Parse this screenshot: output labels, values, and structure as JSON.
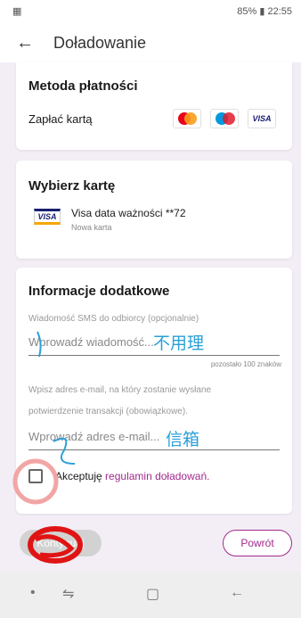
{
  "status_bar": {
    "left_icon": "image-icon",
    "right_text": "85% ▮ 22:55"
  },
  "app_bar": {
    "title": "Doładowanie",
    "back_icon": "←"
  },
  "payment": {
    "title": "Metoda płatności",
    "pay_label": "Zapłać kartą",
    "visa_text": "VISA"
  },
  "card_select": {
    "title": "Wybierz kartę",
    "card_name": "Visa data ważności **72",
    "card_sub": "Nowa karta",
    "visa_text": "VISA"
  },
  "additional": {
    "title": "Informacje dodatkowe",
    "sms_label": "Wiadomość SMS do odbiorcy (opcjonalnie)",
    "sms_placeholder": "Wprowadź wiadomość...",
    "sms_handwritten": "不用理",
    "counter": "pozostało 100 znaków",
    "email_label_line1": "Wpisz adres e-mail, na który zostanie wysłane",
    "email_label_line2": "potwierdzenie transakcji (obowiązkowe).",
    "email_placeholder": "Wprowadź adres e-mail...",
    "email_handwritten": "信箱",
    "accept_prefix": "Akceptuję ",
    "accept_link": "regulamin doładowań."
  },
  "buttons": {
    "next": "Kontynuuj",
    "back": "Powrót"
  },
  "colors": {
    "accent": "#a12a8c",
    "background": "#f3eef6"
  }
}
